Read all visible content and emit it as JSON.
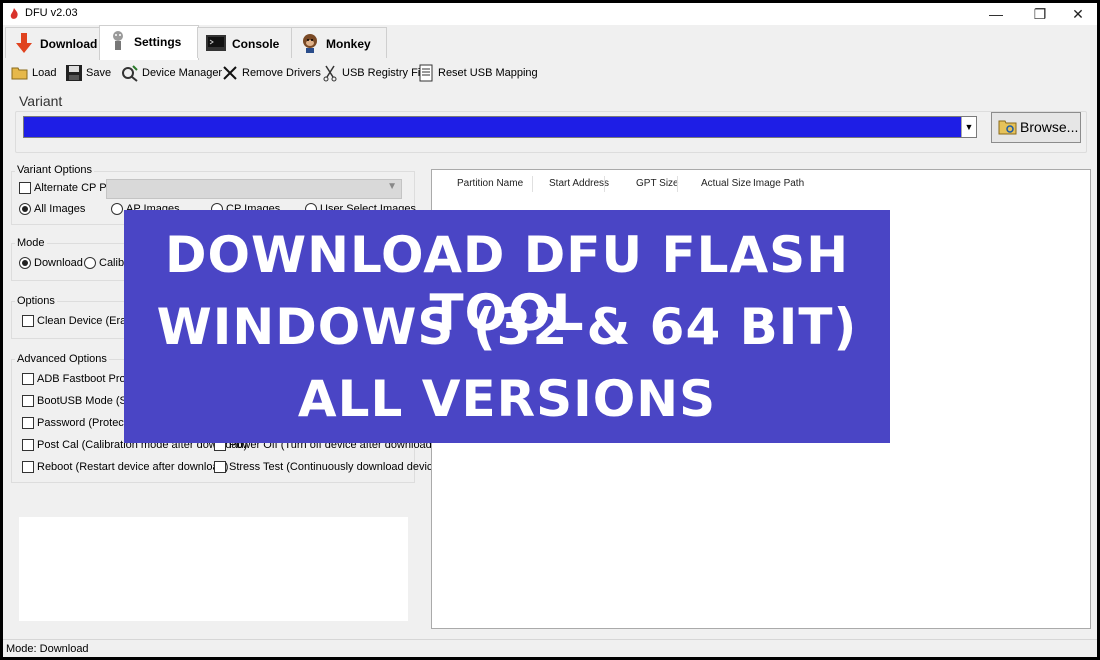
{
  "window": {
    "title": "DFU v2.03",
    "controls": {
      "minimize": "—",
      "restore": "❐",
      "close": "✕"
    }
  },
  "tabs": [
    {
      "label": "Download",
      "icon": "download-arrow-icon"
    },
    {
      "label": "Settings",
      "icon": "settings-robot-icon",
      "active": true
    },
    {
      "label": "Console",
      "icon": "console-icon"
    },
    {
      "label": "Monkey",
      "icon": "monkey-icon"
    }
  ],
  "toolbar": {
    "load": "Load",
    "save": "Save",
    "device_manager": "Device Manager",
    "remove_drivers": "Remove Drivers",
    "usb_registry_fix": "USB Registry Fix",
    "reset_usb_mapping": "Reset USB Mapping"
  },
  "variant": {
    "label": "Variant",
    "selected": "",
    "browse_label": "Browse..."
  },
  "variant_options": {
    "label": "Variant Options",
    "alternate_cp_path": "Alternate CP Path",
    "images": [
      {
        "label": "All Images",
        "checked": true
      },
      {
        "label": "AP Images"
      },
      {
        "label": "CP Images"
      },
      {
        "label": "User Select Images"
      }
    ]
  },
  "mode": {
    "label": "Mode",
    "options": [
      {
        "label": "Download",
        "checked": true
      },
      {
        "label": "Calibra"
      }
    ]
  },
  "options": {
    "label": "Options",
    "clean_device": "Clean Device (Erase se"
  },
  "advanced_options": {
    "label": "Advanced Options",
    "left": [
      "ADB Fastboot Protocol",
      "BootUSB Mode (Skip p",
      "Password (Protect setti",
      "Post Cal (Calibration mode after download)",
      "Reboot (Restart device after download)"
    ],
    "right": [
      "Power Off (Turn off device after download)",
      "Stress Test (Continuously download device)"
    ]
  },
  "partition_table": {
    "columns": [
      "Partition Name",
      "Start Address",
      "GPT Size",
      "Actual Size",
      "Image Path"
    ]
  },
  "banner": {
    "line1": "DOWNLOAD DFU FLASH TOOL",
    "line2": "WINDOWS (32 & 64 BIT)",
    "line3": "ALL VERSIONS",
    "background": "#4a45c5"
  },
  "status": {
    "text": "Mode: Download"
  },
  "colors": {
    "variant_fill": "#1e1ee6",
    "window_bg": "#f0f0f0"
  }
}
